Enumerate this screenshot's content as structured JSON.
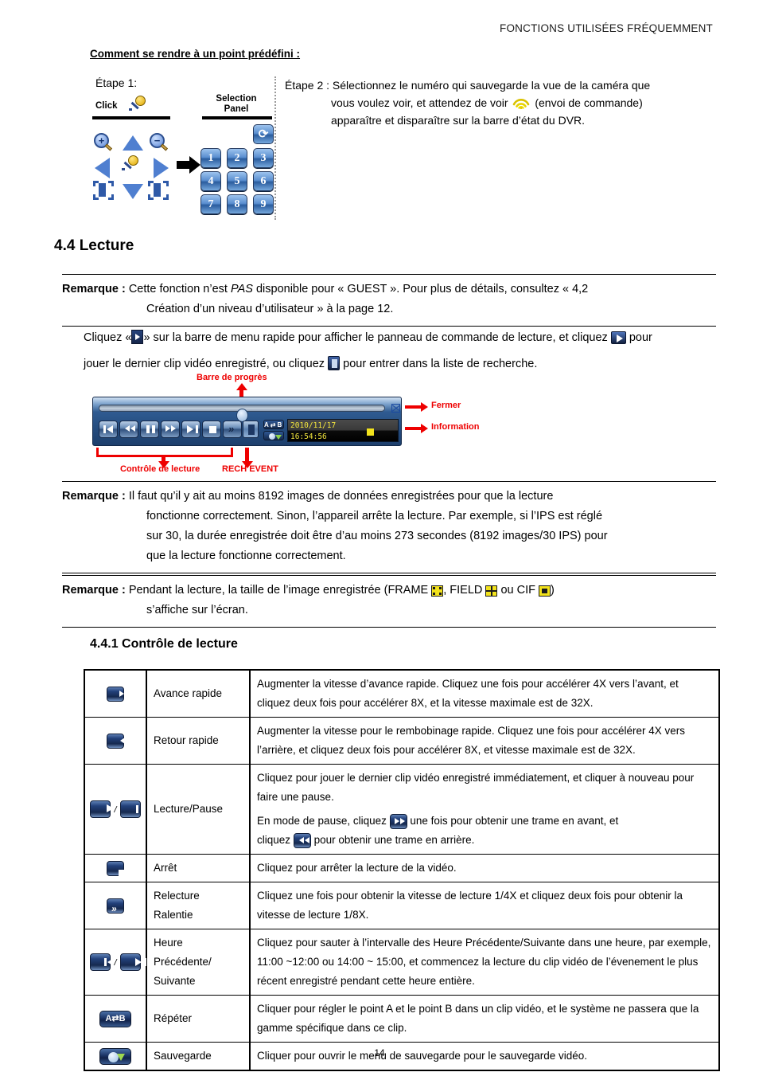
{
  "header": {
    "running_head": "FONCTIONS UTILISÉES FRÉQUEMMENT"
  },
  "preset_section": {
    "title": "Comment se rendre à un point prédéfini :",
    "step1_label": "Étape 1:",
    "diagram": {
      "click_label": "Click",
      "selection_panel_label": "Selection\nPanel",
      "keys": [
        "1",
        "2",
        "3",
        "4",
        "5",
        "6",
        "7",
        "8",
        "9"
      ],
      "return_key": "⟳"
    },
    "step2_line1": "Étape 2 : Sélectionnez le numéro qui sauvegarde la vue de la caméra que",
    "step2_line2": "vous voulez voir, et attendez de voir",
    "step2_line2b": "(envoi de commande)",
    "step2_line3": "apparaître et disparaître sur la barre d’état du DVR."
  },
  "section_44": {
    "heading": "4.4 Lecture",
    "remark1_label": "Remarque :",
    "remark1_line1_a": "Cette fonction n’est ",
    "remark1_line1_italic": "PAS",
    "remark1_line1_b": " disponible pour « GUEST ». Pour plus de détails, consultez « 4,2",
    "remark1_line2": "Création d’un niveau d’utilisateur » à la page 12.",
    "para_a": "Cliquez «",
    "para_b": "» sur la barre de menu rapide pour afficher le panneau de commande de lecture, et cliquez",
    "para_c": "pour",
    "para_d": "jouer le dernier clip vidéo enregistré, ou cliquez",
    "para_e": "pour entrer dans la liste de recherche."
  },
  "figure": {
    "label_progress": "Barre de progrès",
    "label_close": "Fermer",
    "label_information": "Information",
    "label_playback_control": "Contrôle de lecture",
    "label_rech_event": "RECH EVENT",
    "info_date": "2010/11/17",
    "info_time": "16:54:56",
    "ab_label": "A⇄B"
  },
  "remark2": {
    "label": "Remarque :",
    "line1": "Il faut qu’il y ait au moins 8192 images de données enregistrées pour que la lecture",
    "line2": "fonctionne correctement. Sinon, l’appareil arrête la lecture. Par exemple, si l’IPS est réglé",
    "line3": "sur 30, la durée enregistrée doit être d’au moins 273 secondes (8192 images/30 IPS) pour",
    "line4": "que la lecture fonctionne correctement."
  },
  "remark3": {
    "label": "Remarque :",
    "line1_a": "Pendant la lecture, la taille de l’image enregistrée (FRAME",
    "line1_b": ", FIELD",
    "line1_c": "ou CIF",
    "line1_d": ")",
    "line2": "s’affiche sur l’écran."
  },
  "section_441": {
    "heading": "4.4.1 Contrôle de lecture",
    "rows": [
      {
        "icon": "fast-forward",
        "name": "Avance rapide",
        "description": "Augmenter la vitesse d’avance rapide. Cliquez une fois pour accélérer 4X vers l’avant, et cliquez deux fois pour accélérer 8X, et la vitesse maximale est de 32X."
      },
      {
        "icon": "rewind",
        "name": "Retour rapide",
        "description": "Augmenter la vitesse pour le rembobinage rapide. Cliquez une fois pour accélérer 4X vers l’arrière, et cliquez deux fois pour accélérer 8X, et vitesse maximale est de 32X."
      },
      {
        "icon": "play-pause",
        "name": "Lecture/Pause",
        "desc_p1": "Cliquez pour jouer le dernier clip vidéo enregistré immédiatement, et cliquer à nouveau pour faire une pause.",
        "desc_p2_a": "En mode de pause, cliquez",
        "desc_p2_b": "une fois pour obtenir une trame en avant, et",
        "desc_p2_c": "cliquez",
        "desc_p2_d": "pour obtenir une trame en arrière."
      },
      {
        "icon": "stop",
        "name": "Arrêt",
        "description": "Cliquez pour arrêter la lecture de la vidéo."
      },
      {
        "icon": "slow-playback",
        "name": "Relecture Ralentie",
        "name_l1": "Relecture",
        "name_l2": "Ralentie",
        "description": "Cliquez une fois pour obtenir la vitesse de lecture 1/4X et cliquez deux fois pour obtenir la vitesse de lecture 1/8X."
      },
      {
        "icon": "prev-next-hour",
        "name": "Heure Précédente/ Suivante",
        "name_l1": "Heure",
        "name_l2": "Précédente/",
        "name_l3": "Suivante",
        "description": "Cliquez pour sauter à l’intervalle des Heure Précédente/Suivante dans une heure, par exemple, 11:00 ~12:00 ou 14:00 ~ 15:00, et commencez la lecture du clip vidéo de l’évenement le plus récent enregistré pendant cette heure entière."
      },
      {
        "icon": "repeat-ab",
        "name": "Répéter",
        "icon_label": "A⇄B",
        "description": "Cliquer pour régler le point A et le point B dans un clip vidéo, et le système ne passera que la gamme spécifique dans ce clip."
      },
      {
        "icon": "backup",
        "name": "Sauvegarde",
        "description": "Cliquer pour ouvrir le menu de sauvegarde pour le sauvegarde vidéo."
      }
    ]
  },
  "footer": {
    "page_number": "14"
  },
  "colors": {
    "annotation_red": "#ee0000",
    "panel_blue": "#2f5b91",
    "info_yellow": "#f3e63d",
    "icon_navy": "#16294f"
  }
}
